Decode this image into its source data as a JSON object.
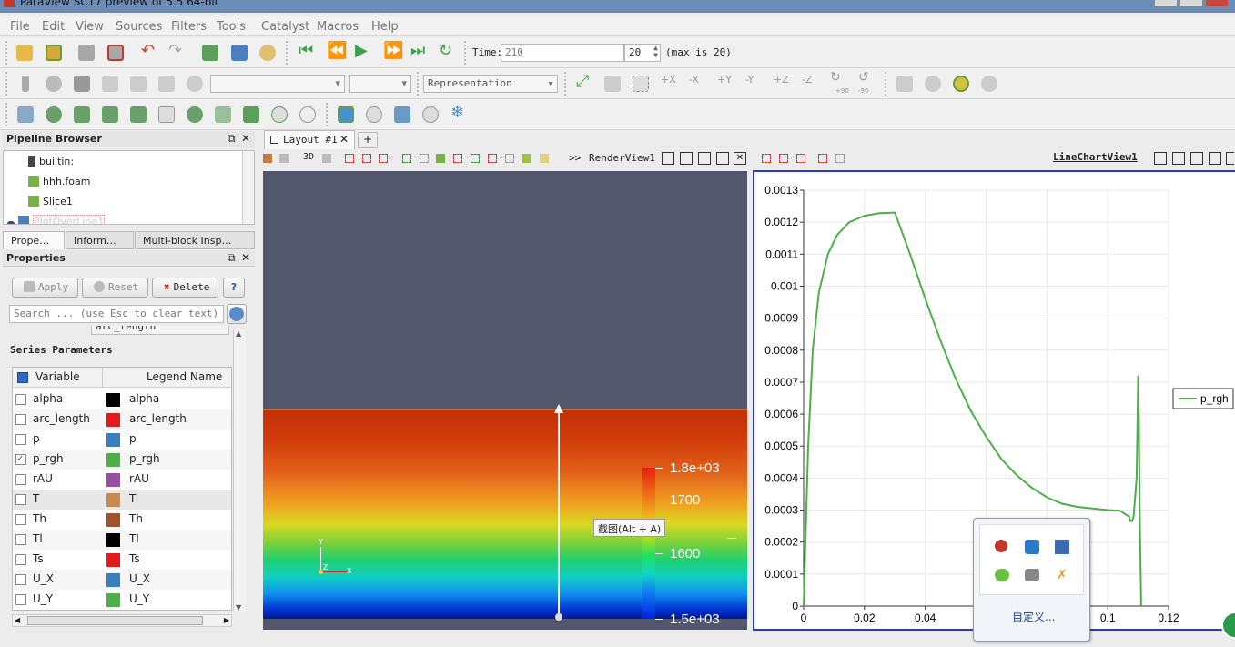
{
  "window": {
    "title": "ParaView SC17 preview of 5.5 64-bit"
  },
  "menubar": [
    "File",
    "Edit",
    "View",
    "Sources",
    "Filters",
    "Tools",
    "Catalyst",
    "Macros",
    "Help"
  ],
  "toolbar": {
    "time_label": "Time:",
    "time_value": "210",
    "timestep_value": "20",
    "max_label": "(max is 20)",
    "representation_placeholder": "Representation",
    "rotate_labels": [
      "+90",
      "-90"
    ]
  },
  "pipeline_browser": {
    "title": "Pipeline Browser",
    "items": [
      {
        "label": "builtin:"
      },
      {
        "label": "hhh.foam"
      },
      {
        "label": "Slice1"
      },
      {
        "label": "PlotOverLine1"
      }
    ]
  },
  "panel_tabs": [
    "Prope…",
    "Inform…",
    "Multi-block Insp…"
  ],
  "properties": {
    "title": "Properties",
    "apply_label": "Apply",
    "reset_label": "Reset",
    "delete_label": "Delete",
    "help_label": "?",
    "search_placeholder": "Search ... (use Esc to clear text)",
    "x_array_value": "arc_length",
    "section_title": "Series Parameters",
    "col_variable": "Variable",
    "col_legend": "Legend Name",
    "series": [
      {
        "variable": "alpha",
        "legend": "alpha",
        "color": "#000000",
        "checked": false
      },
      {
        "variable": "arc_length",
        "legend": "arc_length",
        "color": "#e31a1c",
        "checked": false
      },
      {
        "variable": "p",
        "legend": "p",
        "color": "#3a7ebf",
        "checked": false
      },
      {
        "variable": "p_rgh",
        "legend": "p_rgh",
        "color": "#4daf4a",
        "checked": true
      },
      {
        "variable": "rAU",
        "legend": "rAU",
        "color": "#984ea3",
        "checked": false
      },
      {
        "variable": "T",
        "legend": "T",
        "color": "#c68a4f",
        "checked": false
      },
      {
        "variable": "Th",
        "legend": "Th",
        "color": "#a0522d",
        "checked": false
      },
      {
        "variable": "Tl",
        "legend": "Tl",
        "color": "#000000",
        "checked": false
      },
      {
        "variable": "Ts",
        "legend": "Ts",
        "color": "#e31a1c",
        "checked": false
      },
      {
        "variable": "U_X",
        "legend": "U_X",
        "color": "#3a7ebf",
        "checked": false
      },
      {
        "variable": "U_Y",
        "legend": "U_Y",
        "color": "#4daf4a",
        "checked": false
      }
    ]
  },
  "layout": {
    "tab_label": "Layout #1",
    "add_tab": "+",
    "render_view_label": "RenderView1",
    "chart_view_label": "LineChartView1",
    "btn_3d": "3D",
    "overflow": ">>"
  },
  "colorbar": {
    "labels": [
      "1.8e+03",
      "1700",
      "1600",
      "1.5e+03"
    ]
  },
  "axes_triad": {
    "y": "Y",
    "z": "Z",
    "x": "X"
  },
  "tooltip": {
    "text": "截图(Alt + A)"
  },
  "tray_popup": {
    "customize_label": "自定义..."
  },
  "chart_data": {
    "type": "line",
    "title": "",
    "xlabel": "",
    "ylabel": "",
    "xlim": [
      0,
      0.12
    ],
    "ylim": [
      0,
      0.0013
    ],
    "x_ticks": [
      "0",
      "0.02",
      "0.04",
      "0.06",
      "0.08",
      "0.1",
      "0.12"
    ],
    "y_ticks": [
      "0",
      "0.0001",
      "0.0002",
      "0.0003",
      "0.0004",
      "0.0005",
      "0.0006",
      "0.0007",
      "0.0008",
      "0.0009",
      "0.001",
      "0.0011",
      "0.0012",
      "0.0013"
    ],
    "grid": true,
    "legend_position": "right",
    "series": [
      {
        "name": "p_rgh",
        "color": "#4daf4a",
        "x": [
          0,
          0.0015,
          0.003,
          0.005,
          0.008,
          0.011,
          0.015,
          0.02,
          0.025,
          0.03,
          0.035,
          0.04,
          0.045,
          0.05,
          0.055,
          0.06,
          0.065,
          0.07,
          0.075,
          0.08,
          0.085,
          0.09,
          0.095,
          0.1,
          0.104,
          0.107,
          0.1075,
          0.108,
          0.1085,
          0.1095,
          0.11,
          0.1102,
          0.1105,
          0.111
        ],
        "y": [
          0,
          0.0005,
          0.0008,
          0.00098,
          0.0011,
          0.00116,
          0.0012,
          0.00122,
          0.001228,
          0.00123,
          0.0011,
          0.00096,
          0.00083,
          0.00071,
          0.00061,
          0.00053,
          0.00046,
          0.00041,
          0.00037,
          0.00034,
          0.00032,
          0.00031,
          0.000305,
          0.0003,
          0.000298,
          0.00028,
          0.000265,
          0.000265,
          0.00028,
          0.0004,
          0.00072,
          0.0006,
          0.0003,
          0
        ]
      }
    ]
  }
}
